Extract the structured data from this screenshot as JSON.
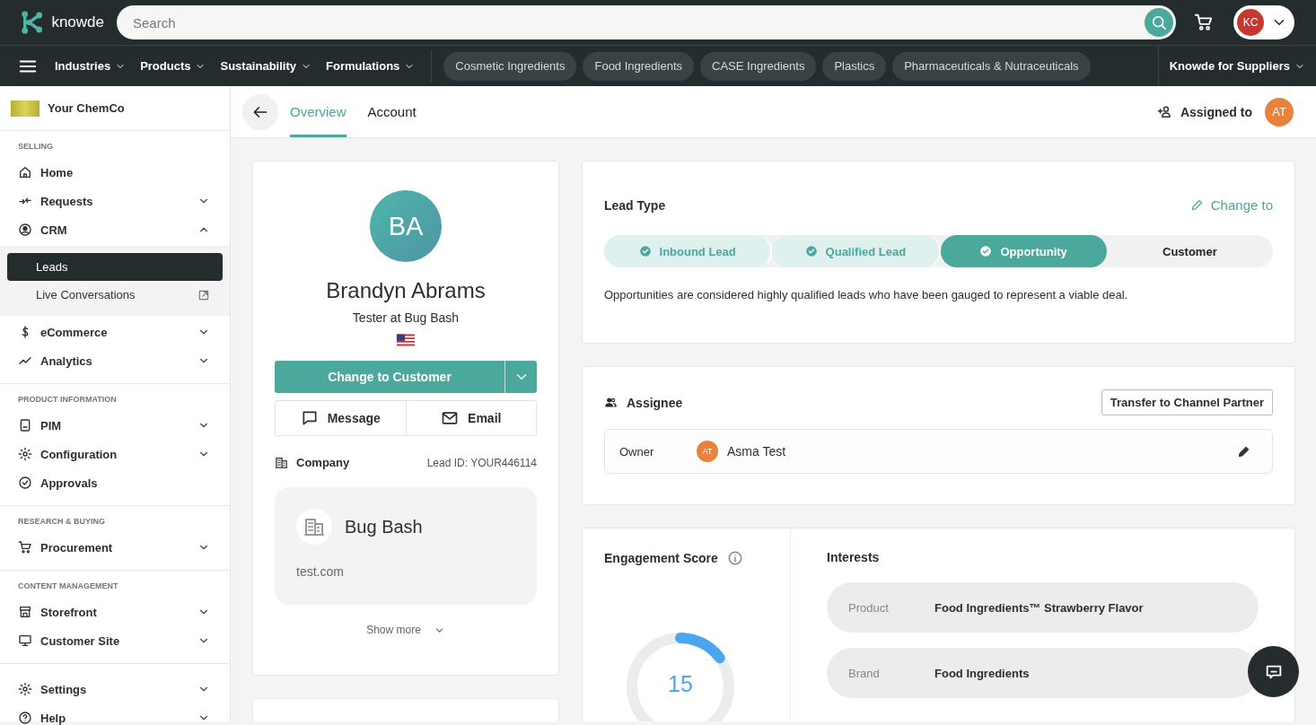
{
  "header": {
    "logo_text": "knowde",
    "search": {
      "placeholder": "Search"
    },
    "user": {
      "initials": "KC"
    }
  },
  "nav": {
    "menus": [
      {
        "label": "Industries"
      },
      {
        "label": "Products"
      },
      {
        "label": "Sustainability"
      },
      {
        "label": "Formulations"
      }
    ],
    "chips": [
      "Cosmetic Ingredients",
      "Food Ingredients",
      "CASE Ingredients",
      "Plastics",
      "Pharmaceuticals & Nutraceuticals"
    ],
    "suppliers_menu": "Knowde for Suppliers"
  },
  "sidebar": {
    "org_name": "Your ChemCo",
    "sections": [
      {
        "title": "SELLING",
        "items": [
          {
            "label": "Home",
            "selected": false
          },
          {
            "label": "Requests",
            "selected": false,
            "expanded": false
          },
          {
            "label": "CRM",
            "selected": false,
            "expanded": true,
            "children": [
              {
                "label": "Leads",
                "selected": true
              },
              {
                "label": "Live Conversations",
                "selected": false,
                "external": true
              }
            ]
          },
          {
            "label": "eCommerce",
            "selected": false,
            "expanded": false
          },
          {
            "label": "Analytics",
            "selected": false,
            "expanded": false
          }
        ]
      },
      {
        "title": "PRODUCT INFORMATION",
        "items": [
          {
            "label": "PIM",
            "selected": false,
            "expanded": false
          },
          {
            "label": "Configuration",
            "selected": false,
            "expanded": false
          },
          {
            "label": "Approvals",
            "selected": false
          }
        ]
      },
      {
        "title": "RESEARCH & BUYING",
        "items": [
          {
            "label": "Procurement",
            "selected": false,
            "expanded": false
          }
        ]
      },
      {
        "title": "CONTENT MANAGEMENT",
        "items": [
          {
            "label": "Storefront",
            "selected": false,
            "expanded": false
          },
          {
            "label": "Customer Site",
            "selected": false,
            "expanded": false
          }
        ]
      },
      {
        "items": [
          {
            "label": "Settings",
            "selected": false,
            "expanded": false
          },
          {
            "label": "Help",
            "selected": false,
            "expanded": false
          }
        ]
      }
    ]
  },
  "tabs": [
    {
      "label": "Overview",
      "selected": true
    },
    {
      "label": "Account",
      "selected": false
    }
  ],
  "assigned": {
    "label": "Assigned to",
    "initials": "AT"
  },
  "profile": {
    "initials": "BA",
    "name": "Brandyn Abrams",
    "subtitle": "Tester at Bug Bash",
    "primary_action": "Change to Customer",
    "actions": [
      "Message",
      "Email"
    ],
    "company_label": "Company",
    "lead_id": "Lead ID: YOUR446114",
    "company": {
      "name": "Bug Bash",
      "website": "test.com"
    },
    "show_more": "Show more"
  },
  "lead_type": {
    "title": "Lead Type",
    "change_link": "Change to",
    "steps": [
      {
        "label": "Inbound Lead",
        "completed": true,
        "selected": false
      },
      {
        "label": "Qualified Lead",
        "completed": true,
        "selected": false
      },
      {
        "label": "Opportunity",
        "completed": true,
        "selected": true
      },
      {
        "label": "Customer",
        "completed": false,
        "selected": false
      }
    ],
    "description": "Opportunities are considered highly qualified leads who have been gauged to represent a viable deal."
  },
  "assignee": {
    "title": "Assignee",
    "transfer_button": "Transfer to Channel Partner",
    "owner": {
      "label": "Owner",
      "initials": "AT",
      "name": "Asma Test"
    }
  },
  "engagement": {
    "title": "Engagement Score",
    "score": "15",
    "level": 0.15
  },
  "interests": {
    "title": "Interests",
    "rows": [
      {
        "label": "Product",
        "value": "Food Ingredients™ Strawberry Flavor"
      },
      {
        "label": "Brand",
        "value": "Food Ingredients"
      }
    ]
  }
}
